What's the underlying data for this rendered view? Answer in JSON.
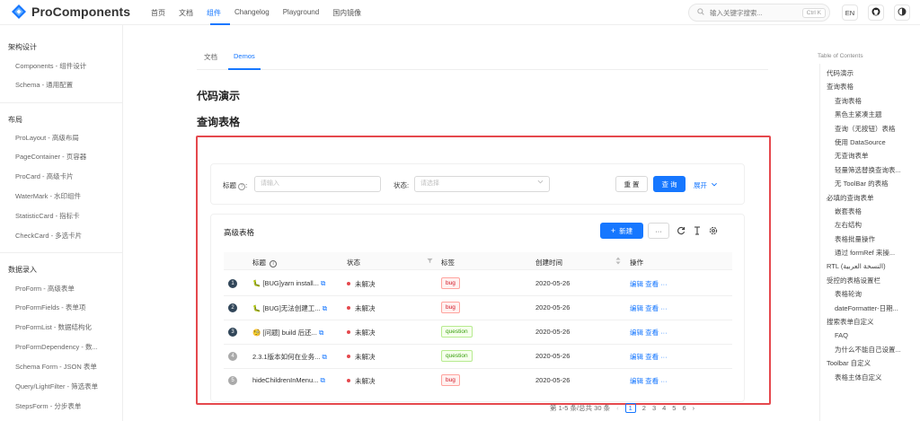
{
  "header": {
    "logo_text": "ProComponents",
    "nav": [
      "首页",
      "文档",
      "组件",
      "Changelog",
      "Playground",
      "国内镜像"
    ],
    "search_placeholder": "输入关键字搜索...",
    "search_shortcut": "Ctrl K",
    "lang_label": "EN",
    "accent": "#1677ff"
  },
  "sidebar": {
    "groups": [
      {
        "title": "架构设计",
        "items": [
          "Components - 组件设计",
          "Schema - 通用配置"
        ]
      },
      {
        "title": "布局",
        "items": [
          "ProLayout - 高级布局",
          "PageContainer - 页容器",
          "ProCard - 高级卡片",
          "WaterMark - 水印组件",
          "StatisticCard - 指标卡",
          "CheckCard - 多选卡片"
        ]
      },
      {
        "title": "数据录入",
        "items": [
          "ProForm - 高级表单",
          "ProFormFields - 表单项",
          "ProFormList - 数据结构化",
          "ProFormDependency - 数...",
          "Schema Form - JSON 表单",
          "Query/LightFilter - 筛选表单",
          "StepsForm - 分步表单"
        ]
      }
    ]
  },
  "main": {
    "tabs": [
      "文档",
      "Demos"
    ],
    "heading_demo": "代码演示",
    "heading_query": "查询表格",
    "filter": {
      "title_label": "标题",
      "title_placeholder": "请输入",
      "status_label": "状态:",
      "status_placeholder": "请选择",
      "reset": "重 置",
      "search": "查 询",
      "expand": "展开"
    },
    "table": {
      "title": "高级表格",
      "new_button": "新建",
      "columns": [
        "标题",
        "状态",
        "标签",
        "创建时间",
        "操作"
      ],
      "rows": [
        {
          "index": "1",
          "title": "🐛 [BUG]yarn install...",
          "status": "未解决",
          "tag": "bug",
          "created": "2020-05-26",
          "edit": "编辑",
          "view": "查看"
        },
        {
          "index": "2",
          "title": "🐛 [BUG]无法创建工...",
          "status": "未解决",
          "tag": "bug",
          "created": "2020-05-26",
          "edit": "编辑",
          "view": "查看"
        },
        {
          "index": "3",
          "title": "🧐 [问题] build 后还...",
          "status": "未解决",
          "tag": "question",
          "created": "2020-05-26",
          "edit": "编辑",
          "view": "查看"
        },
        {
          "index": "4",
          "title": "2.3.1版本如何在业务...",
          "status": "未解决",
          "tag": "question",
          "created": "2020-05-26",
          "edit": "编辑",
          "view": "查看"
        },
        {
          "index": "5",
          "title": "hideChildrenInMenu...",
          "status": "未解决",
          "tag": "bug",
          "created": "2020-05-26",
          "edit": "编辑",
          "view": "查看"
        }
      ]
    },
    "pagination": {
      "summary": "第 1-5 条/总共 30 条",
      "pages": [
        "1",
        "2",
        "3",
        "4",
        "5",
        "6"
      ]
    }
  },
  "toc": {
    "title": "Table of Contents",
    "items": [
      {
        "label": "代码演示",
        "level": 1
      },
      {
        "label": "查询表格",
        "level": 1
      },
      {
        "label": "查询表格",
        "level": 2
      },
      {
        "label": "黑色主紧凑主题",
        "level": 2
      },
      {
        "label": "查询（无按钮）表格",
        "level": 2
      },
      {
        "label": "使用 DataSource",
        "level": 2
      },
      {
        "label": "无查询表单",
        "level": 2
      },
      {
        "label": "轻量筛选替换查询表...",
        "level": 2
      },
      {
        "label": "无 ToolBar 的表格",
        "level": 2
      },
      {
        "label": "必填的查询表单",
        "level": 1
      },
      {
        "label": "嵌套表格",
        "level": 2
      },
      {
        "label": "左右结构",
        "level": 2
      },
      {
        "label": "表格批量操作",
        "level": 2
      },
      {
        "label": "通过 formRef 来操...",
        "level": 2
      },
      {
        "label": "RTL (النسخة العربية)",
        "level": 1
      },
      {
        "label": "受控的表格设置栏",
        "level": 1
      },
      {
        "label": "表格轮询",
        "level": 2
      },
      {
        "label": "dateFormatter-日期...",
        "level": 2
      },
      {
        "label": "搜索表单自定义",
        "level": 1
      },
      {
        "label": "FAQ",
        "level": 2
      },
      {
        "label": "为什么不能自己设置...",
        "level": 2
      },
      {
        "label": "Toolbar 自定义",
        "level": 1
      },
      {
        "label": "表格主体自定义",
        "level": 2
      }
    ]
  }
}
